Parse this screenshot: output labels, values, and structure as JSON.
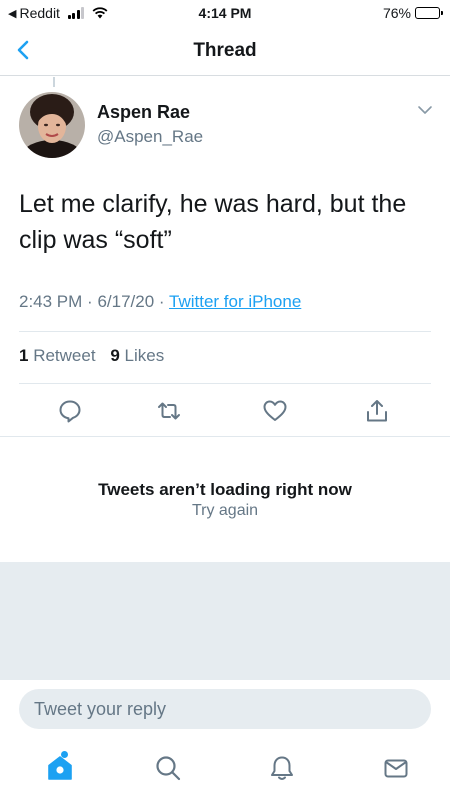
{
  "status_bar": {
    "back_app": "Reddit",
    "time": "4:14 PM",
    "battery": "76%",
    "battery_level": 0.76
  },
  "nav": {
    "title": "Thread"
  },
  "tweet": {
    "display_name": "Aspen Rae",
    "handle": "@Aspen_Rae",
    "text": "Let me clarify, he was hard, but the clip was “soft”",
    "time": "2:43 PM",
    "date": "6/17/20",
    "separator": "·",
    "source": "Twitter for iPhone",
    "retweet_count": "1",
    "retweet_label": "Retweet",
    "like_count": "9",
    "like_label": "Likes"
  },
  "error": {
    "title": "Tweets aren’t loading right now",
    "retry": "Try again"
  },
  "reply": {
    "placeholder": "Tweet your reply"
  },
  "tabs": [
    {
      "name": "home",
      "icon": "home-icon",
      "active": true
    },
    {
      "name": "search",
      "icon": "search-icon"
    },
    {
      "name": "notifications",
      "icon": "bell-icon"
    },
    {
      "name": "messages",
      "icon": "mail-icon"
    }
  ],
  "colors": {
    "accent": "#1da1f2",
    "text": "#14171a",
    "secondary": "#657786",
    "background_gray": "#e6ecf0"
  }
}
